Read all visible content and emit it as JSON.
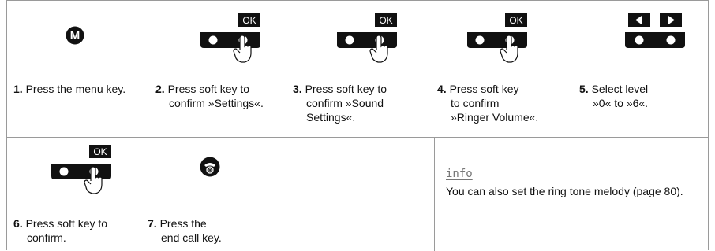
{
  "ok_label": "OK",
  "menu_key_letter": "M",
  "steps": [
    {
      "num": "1.",
      "line1": "Press the menu key.",
      "line2": "",
      "line3": ""
    },
    {
      "num": "2.",
      "line1": "Press soft key to",
      "line2": "confirm »Settings«.",
      "line3": ""
    },
    {
      "num": "3.",
      "line1": "Press soft key to",
      "line2": "confirm »Sound",
      "line3": "Settings«."
    },
    {
      "num": "4.",
      "line1": "Press soft key",
      "line2": "to confirm",
      "line3": "»Ringer  Volume«."
    },
    {
      "num": "5.",
      "line1": "Select level",
      "line2": "»0« to »6«.",
      "line3": ""
    },
    {
      "num": "6.",
      "line1": "Press soft key to",
      "line2": "confirm.",
      "line3": ""
    },
    {
      "num": "7.",
      "line1": "Press the",
      "line2": "end call key.",
      "line3": ""
    }
  ],
  "info": {
    "title": "info",
    "text": "You can also set the ring tone melody (page 80)."
  },
  "icons": [
    "menu-key-icon",
    "ok-softkey-icon",
    "arrow-keys-icon",
    "end-call-key-icon",
    "finger-press-icon"
  ]
}
